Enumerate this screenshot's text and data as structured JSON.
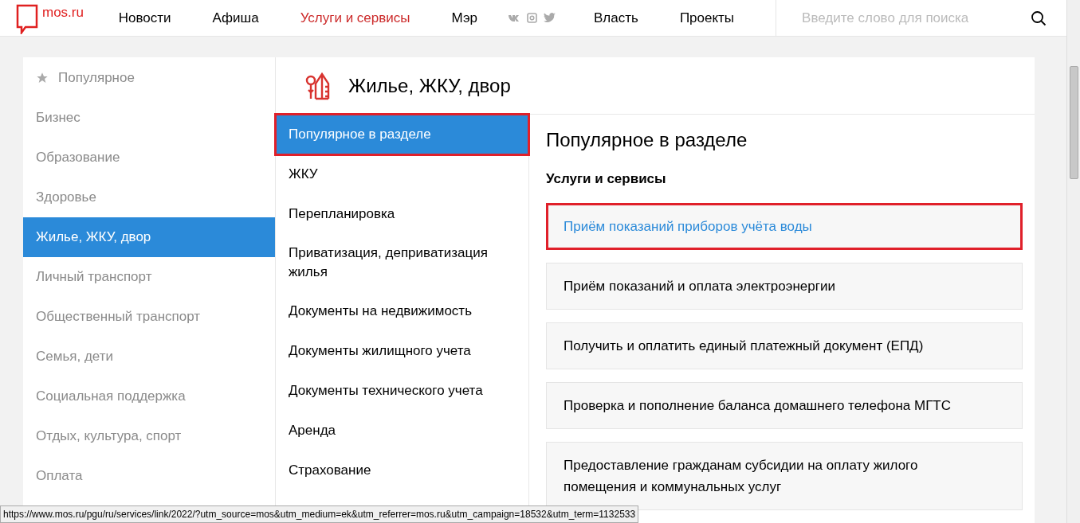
{
  "header": {
    "logo": "mos.ru",
    "nav": [
      {
        "label": "Новости",
        "selected": false
      },
      {
        "label": "Афиша",
        "selected": false
      },
      {
        "label": "Услуги и сервисы",
        "selected": true
      },
      {
        "label": "Мэр",
        "selected": false
      }
    ],
    "nav_after_social": [
      {
        "label": "Власть",
        "selected": false
      },
      {
        "label": "Проекты",
        "selected": false
      }
    ],
    "search": {
      "placeholder": "Введите слово для поиска"
    }
  },
  "sidebar": {
    "items": [
      {
        "label": "Популярное",
        "selected": false,
        "kind": "starred"
      },
      {
        "label": "Бизнес",
        "selected": false,
        "kind": "plain"
      },
      {
        "label": "Образование",
        "selected": false,
        "kind": "plain"
      },
      {
        "label": "Здоровье",
        "selected": false,
        "kind": "plain"
      },
      {
        "label": "Жилье, ЖКУ, двор",
        "selected": true,
        "kind": "plain"
      },
      {
        "label": "Личный транспорт",
        "selected": false,
        "kind": "plain"
      },
      {
        "label": "Общественный транспорт",
        "selected": false,
        "kind": "plain"
      },
      {
        "label": "Семья, дети",
        "selected": false,
        "kind": "plain"
      },
      {
        "label": "Социальная поддержка",
        "selected": false,
        "kind": "plain"
      },
      {
        "label": "Отдых, культура, спорт",
        "selected": false,
        "kind": "plain"
      },
      {
        "label": "Оплата",
        "selected": false,
        "kind": "plain"
      }
    ]
  },
  "section": {
    "title": "Жилье, ЖКУ, двор"
  },
  "subsections": [
    {
      "label": "Популярное в разделе",
      "selected": true,
      "annotated": true
    },
    {
      "label": "ЖКУ",
      "selected": false,
      "annotated": false
    },
    {
      "label": "Перепланировка",
      "selected": false,
      "annotated": false
    },
    {
      "label": "Приватизация, деприватизация жилья",
      "selected": false,
      "annotated": false
    },
    {
      "label": "Документы на недвижимость",
      "selected": false,
      "annotated": false
    },
    {
      "label": "Документы жилищного учета",
      "selected": false,
      "annotated": false
    },
    {
      "label": "Документы технического учета",
      "selected": false,
      "annotated": false
    },
    {
      "label": "Аренда",
      "selected": false,
      "annotated": false
    },
    {
      "label": "Страхование",
      "selected": false,
      "annotated": false
    }
  ],
  "content": {
    "title": "Популярное в разделе",
    "subtitle": "Услуги и сервисы",
    "services": [
      {
        "label": "Приём показаний приборов учёта воды",
        "hovered": true,
        "annotated": true
      },
      {
        "label": "Приём показаний и оплата электроэнергии",
        "hovered": false,
        "annotated": false
      },
      {
        "label": "Получить и оплатить единый платежный документ (ЕПД)",
        "hovered": false,
        "annotated": false
      },
      {
        "label": "Проверка и пополнение баланса домашнего телефона МГТС",
        "hovered": false,
        "annotated": false
      },
      {
        "label": "Предоставление гражданам субсидии на оплату жилого помещения и коммунальных услуг",
        "hovered": false,
        "annotated": false
      }
    ]
  },
  "status_bar": {
    "url": "https://www.mos.ru/pgu/ru/services/link/2022/?utm_source=mos&utm_medium=ek&utm_referrer=mos.ru&utm_campaign=18532&utm_term=1132533"
  }
}
